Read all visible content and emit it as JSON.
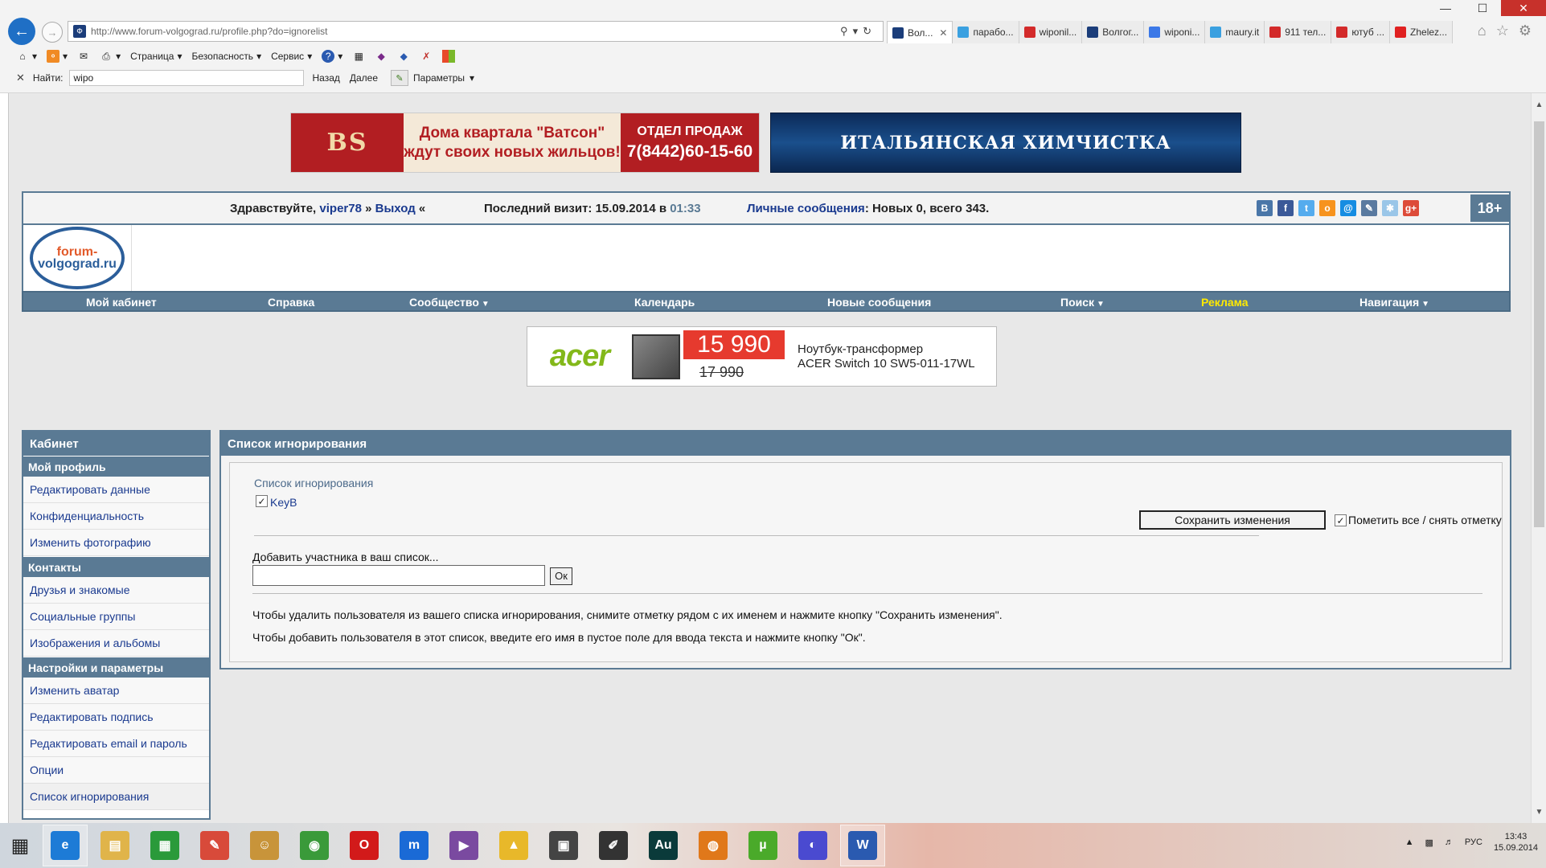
{
  "browser": {
    "url": "http://www.forum-volgograd.ru/profile.php?do=ignorelist",
    "tabs": [
      {
        "label": "Вол...",
        "icon": "forum-icon",
        "color": "#1b3d7a",
        "active": true
      },
      {
        "label": "парабо...",
        "icon": "ie-icon",
        "color": "#3aa0e0"
      },
      {
        "label": "wiponil...",
        "icon": "yandex-icon",
        "color": "#d32a2a"
      },
      {
        "label": "Волгог...",
        "icon": "forum-icon",
        "color": "#1b3d7a"
      },
      {
        "label": "wiponi...",
        "icon": "google-icon",
        "color": "#3b78e7"
      },
      {
        "label": "maury.it",
        "icon": "ie-icon",
        "color": "#3aa0e0"
      },
      {
        "label": "911 тел...",
        "icon": "yandex-icon",
        "color": "#d32a2a"
      },
      {
        "label": "ютуб ...",
        "icon": "yandex-icon",
        "color": "#d32a2a"
      },
      {
        "label": "Zhelez...",
        "icon": "youtube-icon",
        "color": "#e02020"
      }
    ],
    "commands": {
      "page": "Страница",
      "security": "Безопасность",
      "service": "Сервис"
    },
    "find": {
      "label": "Найти:",
      "value": "wipo",
      "back": "Назад",
      "next": "Далее",
      "params": "Параметры"
    }
  },
  "ads": {
    "banner1_logo": "BS",
    "banner1_text": "Дома квартала \"Ватсон\" ждут своих новых жильцов!",
    "banner1_sale_title": "ОТДЕЛ ПРОДАЖ",
    "banner1_sale_phone": "7(8442)60-15-60",
    "banner2_text": "ИТАЛЬЯНСКАЯ ХИМЧИСТКА",
    "acer_brand": "acer",
    "acer_price": "15 990",
    "acer_old_price": "17 990",
    "acer_title": "Ноутбук-трансформер",
    "acer_model": "ACER Switch 10 SW5-011-17WL"
  },
  "topbar": {
    "hello": "Здравствуйте,",
    "user": "viper78",
    "sep": "»",
    "logout": "Выход",
    "sep2": "«",
    "last_visit_label": "Последний визит: 15.09.2014 в",
    "last_visit_time": "01:33",
    "pm_label": "Личные сообщения",
    "pm_stats": ": Новых 0, всего 343.",
    "age": "18+"
  },
  "logo": {
    "line1": "forum-",
    "line2": "volgograd.ru"
  },
  "nav": {
    "cabinet": "Мой кабинет",
    "help": "Справка",
    "community": "Сообщество",
    "calendar": "Календарь",
    "new_posts": "Новые сообщения",
    "search": "Поиск",
    "ads": "Реклама",
    "navigation": "Навигация"
  },
  "sidebar": {
    "title": "Кабинет",
    "sections": [
      {
        "title": "Мой профиль",
        "items": [
          "Редактировать данные",
          "Конфиденциальность",
          "Изменить фотографию"
        ]
      },
      {
        "title": "Контакты",
        "items": [
          "Друзья и знакомые",
          "Социальные группы",
          "Изображения и альбомы"
        ]
      },
      {
        "title": "Настройки и параметры",
        "items": [
          "Изменить аватар",
          "Редактировать подпись",
          "Редактировать email и пароль",
          "Опции",
          "Список игнорирования"
        ]
      }
    ]
  },
  "main": {
    "title": "Список игнорирования",
    "list_label": "Список игнорирования",
    "users": [
      {
        "name": "KeyB",
        "checked": true
      }
    ],
    "save_button": "Сохранить изменения",
    "mark_all": "Пометить все / снять отметку",
    "add_label": "Добавить участника в ваш список...",
    "add_value": "",
    "ok_button": "Ок",
    "help1": "Чтобы удалить пользователя из вашего списка игнорирования, снимите отметку рядом с их именем и нажмите кнопку \"Сохранить изменения\".",
    "help2": "Чтобы добавить пользователя в этот список, введите его имя в пустое поле для ввода текста и нажмите кнопку \"Ок\"."
  },
  "taskbar": {
    "apps": [
      {
        "name": "ie-icon",
        "glyph": "e",
        "color": "#1d7bd6",
        "active": true
      },
      {
        "name": "file-explorer-icon",
        "glyph": "▤",
        "color": "#e0b44a"
      },
      {
        "name": "store-icon",
        "glyph": "▦",
        "color": "#2a9a3a"
      },
      {
        "name": "eraser-icon",
        "glyph": "✎",
        "color": "#d84a3a"
      },
      {
        "name": "contacts-icon",
        "glyph": "☺",
        "color": "#c8943a"
      },
      {
        "name": "chrome-icon",
        "glyph": "◉",
        "color": "#3a9a3a"
      },
      {
        "name": "opera-icon",
        "glyph": "O",
        "color": "#d21a1a"
      },
      {
        "name": "maxthon-icon",
        "glyph": "m",
        "color": "#1a6ad6"
      },
      {
        "name": "visual-studio-icon",
        "glyph": "▶",
        "color": "#7a4aa0"
      },
      {
        "name": "google-drive-icon",
        "glyph": "▲",
        "color": "#e8b82a"
      },
      {
        "name": "video-editor-icon",
        "glyph": "▣",
        "color": "#444444"
      },
      {
        "name": "sketch-tool-icon",
        "glyph": "✐",
        "color": "#333333"
      },
      {
        "name": "audition-icon",
        "glyph": "Au",
        "color": "#0a3a3a"
      },
      {
        "name": "firefox-icon",
        "glyph": "◍",
        "color": "#e0781a"
      },
      {
        "name": "utorrent-icon",
        "glyph": "µ",
        "color": "#4aaa2a"
      },
      {
        "name": "app-icon",
        "glyph": "◐",
        "color": "#4a4ad0"
      },
      {
        "name": "word-icon",
        "glyph": "W",
        "color": "#2a5ab0",
        "active": true
      }
    ],
    "lang": "РУС",
    "time": "13:43",
    "date": "15.09.2014"
  }
}
